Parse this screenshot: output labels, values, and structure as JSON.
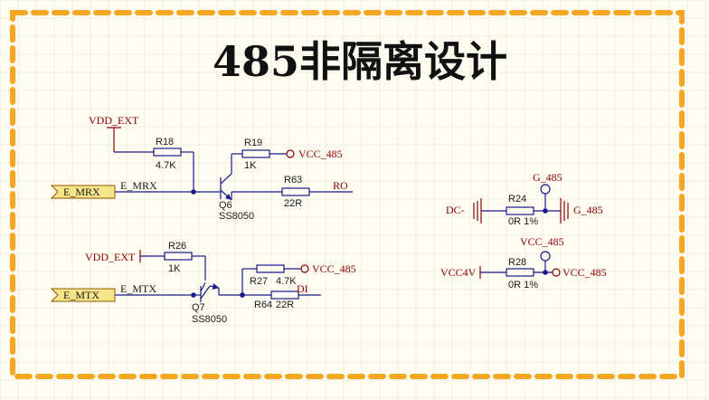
{
  "title": "485非隔离设计",
  "colors": {
    "border": "#f5a623",
    "grid": "#e6e2cf",
    "wire": "#1a1a8a",
    "net_label": "#8b0000",
    "port_fill": "#f7e58a",
    "background": "#fffdf2"
  },
  "ports": {
    "e_mrx": "E_MRX",
    "e_mtx": "E_MTX"
  },
  "nets": {
    "vdd_ext_1": "VDD_EXT",
    "vdd_ext_2": "VDD_EXT",
    "e_mrx": "E_MRX",
    "e_mtx": "E_MTX",
    "vcc485_1": "VCC_485",
    "vcc485_2": "VCC_485",
    "vcc485_3": "VCC_485",
    "vcc485_4": "VCC_485",
    "ro": "RO",
    "di": "DI",
    "dc_minus": "DC-",
    "g485_top": "G_485",
    "g485_right": "G_485",
    "vcc4v": "VCC4V"
  },
  "components": {
    "r18": {
      "ref": "R18",
      "value": "4.7K"
    },
    "r19": {
      "ref": "R19",
      "value": "1K"
    },
    "r63": {
      "ref": "R63",
      "value": "22R"
    },
    "q6": {
      "ref": "Q6",
      "value": "SS8050"
    },
    "r26": {
      "ref": "R26",
      "value": "1K"
    },
    "q7": {
      "ref": "Q7",
      "value": "SS8050"
    },
    "r27": {
      "ref": "R27",
      "value": "4.7K"
    },
    "r64": {
      "ref": "R64",
      "value": "22R"
    },
    "r24": {
      "ref": "R24",
      "value": "0R 1%"
    },
    "r28": {
      "ref": "R28",
      "value": "0R 1%"
    }
  }
}
